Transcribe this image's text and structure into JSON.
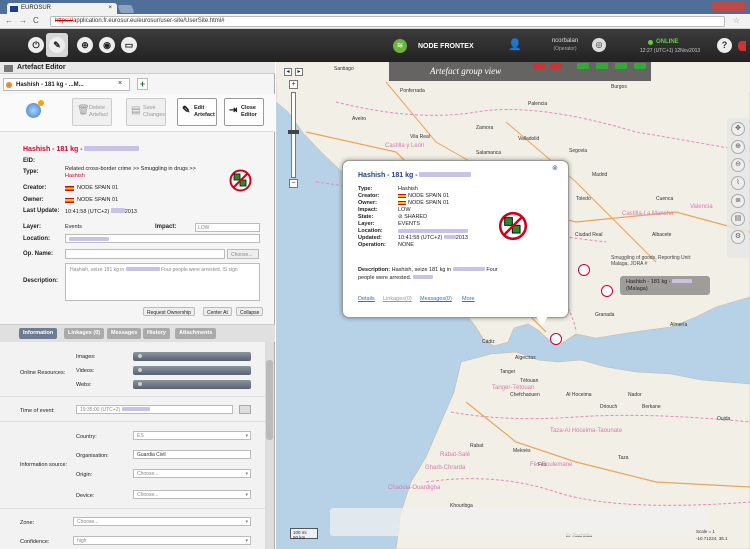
{
  "browser": {
    "tab_title": "EUROSUR",
    "url_scheme": "https://",
    "url_rest": "application.fr.eurosur.eu/eurosur/user-site/UserSite.html#"
  },
  "topbar": {
    "node_name": "NODE FRONTEX",
    "user_name": "ncorbalan",
    "user_role": "(Operator)",
    "status": "ONLINE",
    "clock": "12:27 (UTC+1) 12Nov2013",
    "help": "?"
  },
  "editor": {
    "title": "Artefact Editor",
    "tab_label": "Hashish - 181 kg - ...M...",
    "buttons": {
      "delete": "Delete Artefact",
      "save": "Save Changes",
      "edit": "Edit Artefact",
      "close": "Close Editor"
    },
    "heading": "Hashish - 181 kg -",
    "fields": {
      "eid_label": "EID:",
      "type_label": "Type:",
      "type_value": "Related cross-border crime >> Smuggling in drugs >>",
      "type_value2": "Hashish",
      "creator_label": "Creator:",
      "creator_value": "NODE SPAIN 01",
      "owner_label": "Owner:",
      "owner_value": "NODE SPAIN 01",
      "last_update_label": "Last Update:",
      "last_update_value": "10:41:58 (UTC+2)",
      "last_update_year": "2013",
      "layer_label": "Layer:",
      "layer_value": "Events",
      "impact_label": "Impact:",
      "impact_value": "LOW",
      "location_label": "Location:",
      "opname_label": "Op. Name:",
      "opname_btn": "Choose...",
      "description_label": "Description:",
      "description_value": "Hashish, seize 181 kg in",
      "description_value2": "Four people were arrested. IS sign"
    },
    "actions": {
      "request_ownership": "Request Ownership",
      "center_at": "Center At",
      "collapse": "Collapse"
    },
    "info_tabs": [
      "Information",
      "Linkages (0)",
      "Messages",
      "History",
      "Attachments"
    ],
    "details": {
      "images_label": "Images:",
      "videos_label": "Videos:",
      "webs_label": "Webs:",
      "online_resources_label": "Online Resources:",
      "time_of_event_label": "Time of event:",
      "time_of_event_value": "19:35:00 (UTC+2)",
      "country_label": "Country:",
      "country_value": "ES",
      "organisation_label": "Organisation:",
      "organisation_value": "Guardia Civil",
      "information_source_label": "Information source:",
      "origin_label": "Origin:",
      "origin_value": "Choose...",
      "device_label": "Device:",
      "device_value": "Choose...",
      "zone_label": "Zone:",
      "zone_value": "Choose...",
      "confidence_label": "Confidence:",
      "confidence_value": "high"
    }
  },
  "map": {
    "group_title": "Artefact group view",
    "popup": {
      "title": "Hashish - 181 kg -",
      "type_label": "Type:",
      "type_value": "Hashish",
      "creator_label": "Creator:",
      "creator_value": "NODE SPAIN 01",
      "owner_label": "Owner:",
      "owner_value": "NODE SPAIN 01",
      "impact_label": "Impact:",
      "impact_value": "LOW",
      "state_label": "State:",
      "state_value": "SHARED",
      "layer_label": "Layer:",
      "layer_value": "EVENTS",
      "location_label": "Location:",
      "updated_label": "Updated:",
      "updated_value": "10:41:58 (UTC+2)",
      "updated_year": "2013",
      "operation_label": "Operation:",
      "operation_value": "NONE",
      "description_label": "Description:",
      "description_value": "Hashish, seize 181 kg in",
      "description_value2": "Four",
      "description_value3": "people were arrested.",
      "links": [
        "Details",
        "Linkages(0)",
        "Messages(0)",
        "More"
      ],
      "close": "⊗"
    },
    "tooltip": "Hashish - 181 kg -",
    "tooltip2": "(Malaga)",
    "smuggling_text": "Smuggling of goods, Reporting Unit:",
    "smuggling_text2": "Malaga, JORA #",
    "scale": [
      "100 mi",
      "50 km"
    ],
    "coords": [
      "Scale = 1",
      "-10.71224, 36.1"
    ],
    "cities": [
      {
        "name": "Santiago",
        "pink": false
      },
      {
        "name": "Ponferrada",
        "pink": false
      },
      {
        "name": "Vila Real",
        "pink": false
      },
      {
        "name": "Zamora",
        "pink": false
      },
      {
        "name": "Salamanca",
        "pink": false
      },
      {
        "name": "Segovia",
        "pink": false
      },
      {
        "name": "Madrid",
        "pink": false
      },
      {
        "name": "Toledo",
        "pink": false
      },
      {
        "name": "Cuenca",
        "pink": false
      },
      {
        "name": "Ciudad Real",
        "pink": false
      },
      {
        "name": "Albacete",
        "pink": false
      },
      {
        "name": "Granada",
        "pink": false
      },
      {
        "name": "Almería",
        "pink": false
      },
      {
        "name": "Cádiz",
        "pink": false
      },
      {
        "name": "Algeciras",
        "pink": false
      },
      {
        "name": "Tanger",
        "pink": false
      },
      {
        "name": "Tétouan",
        "pink": false
      },
      {
        "name": "Chefchaouen",
        "pink": false
      },
      {
        "name": "Al Hoceima",
        "pink": false
      },
      {
        "name": "Nador",
        "pink": false
      },
      {
        "name": "Driouch",
        "pink": false
      },
      {
        "name": "Berkane",
        "pink": false
      },
      {
        "name": "Rabat",
        "pink": false
      },
      {
        "name": "Meknès",
        "pink": false
      },
      {
        "name": "Fès",
        "pink": false
      },
      {
        "name": "Castilla y León",
        "pink": true
      },
      {
        "name": "Castilla-La Mancha",
        "pink": true
      },
      {
        "name": "Valencia",
        "pink": true
      },
      {
        "name": "Tanger-Tétouan",
        "pink": true
      },
      {
        "name": "Taza-Al Hoceima-Taounate",
        "pink": true
      },
      {
        "name": "Fès-Boulemane",
        "pink": true
      },
      {
        "name": "Gharb-Chrarda",
        "pink": true
      },
      {
        "name": "Rabat-Salé",
        "pink": true
      },
      {
        "name": "Chaouia-Ouardigha",
        "pink": true
      },
      {
        "name": "Valladolid",
        "pink": false
      },
      {
        "name": "Palencia",
        "pink": false
      },
      {
        "name": "Burgos",
        "pink": false
      },
      {
        "name": "Aveiro",
        "pink": false
      },
      {
        "name": "Oujda",
        "pink": false
      },
      {
        "name": "Taza",
        "pink": false
      },
      {
        "name": "Khouribga",
        "pink": false
      },
      {
        "name": "Er Rachidia",
        "pink": false
      }
    ]
  },
  "colors": {
    "accent": "#c03",
    "online": "#5cd13b",
    "sea": "#b7d1e7",
    "land": "#f2efe6"
  }
}
